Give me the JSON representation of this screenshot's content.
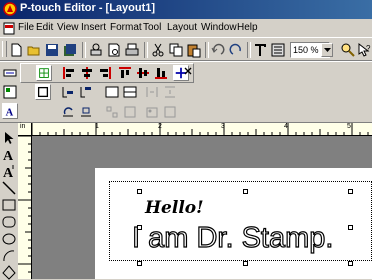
{
  "window": {
    "title": "P-touch Editor - [Layout1]"
  },
  "menu": {
    "items": [
      "File",
      "Edit",
      "View",
      "Insert",
      "Format",
      "Tool",
      "Layout",
      "Window",
      "Help"
    ]
  },
  "toolbar": {
    "zoom_value": "150 %"
  },
  "rulers": {
    "h_marks": [
      "1",
      "2",
      "3",
      "4",
      "5"
    ],
    "corner": "in"
  },
  "label": {
    "line1": "Hello!",
    "line2": "I am Dr. Stamp."
  },
  "colors": {
    "titlebar_start": "#0a246a",
    "titlebar_end": "#3a6ea5",
    "workspace": "#808080",
    "ruler": "#ffffe8"
  }
}
